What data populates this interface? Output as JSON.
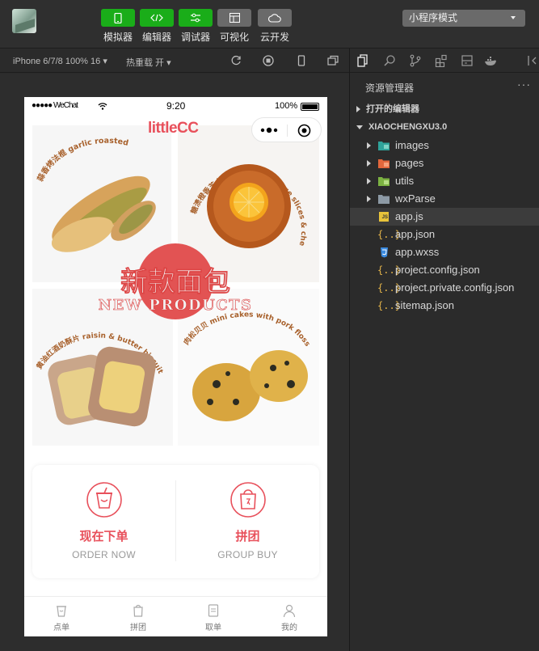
{
  "toolbar": {
    "buttons": [
      {
        "label": "模拟器",
        "style": "green"
      },
      {
        "label": "编辑器",
        "style": "green"
      },
      {
        "label": "调试器",
        "style": "green"
      },
      {
        "label": "可视化",
        "style": "gray"
      },
      {
        "label": "云开发",
        "style": "gray"
      }
    ],
    "mode": "小程序模式"
  },
  "simulator": {
    "device": "iPhone 6/7/8 100% 16",
    "hot_reload": "热重载 开"
  },
  "phone": {
    "carrier": "●●●●● WeChat",
    "time": "9:20",
    "battery": "100%",
    "logo": "littleCC",
    "banner": {
      "cn_title": "新款面包",
      "en_title": "NEW PRODUCTS",
      "items": [
        {
          "caption": "蒜香烤法棍 garlic roasted"
        },
        {
          "caption": "糖渍橙香芝士包 candied orange slices & cheese bread"
        },
        {
          "caption": "黄油红酒奶酥片 raisin & butter biscuit"
        },
        {
          "caption": "肉松贝贝 mini cakes with pork floss"
        }
      ]
    },
    "actions": [
      {
        "cn": "现在下单",
        "en": "ORDER NOW"
      },
      {
        "cn": "拼团",
        "en": "GROUP BUY"
      }
    ],
    "tabs": [
      "点单",
      "拼团",
      "取单",
      "我的"
    ]
  },
  "explorer": {
    "title": "资源管理器",
    "open_editors": "打开的编辑器",
    "project": "XIAOCHENGXU3.0",
    "folders": [
      "images",
      "pages",
      "utils",
      "wxParse"
    ],
    "files": [
      "app.js",
      "app.json",
      "app.wxss",
      "project.config.json",
      "project.private.config.json",
      "sitemap.json"
    ],
    "selected": "app.js"
  },
  "colors": {
    "accent": "#e8505b",
    "wechat_green": "#1aad19"
  }
}
